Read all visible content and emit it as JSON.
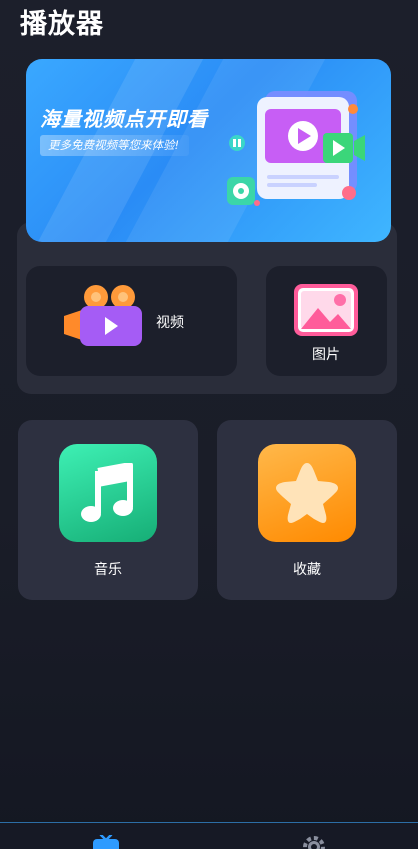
{
  "app": {
    "title": "播放器"
  },
  "banner": {
    "headline": "海量视频点开即看",
    "subtitle": "更多免费视频等您来体验!"
  },
  "cards": {
    "video": {
      "label": "视频",
      "icon": "video-camera-icon"
    },
    "photo": {
      "label": "图片",
      "icon": "image-icon"
    },
    "music": {
      "label": "音乐",
      "icon": "music-note-icon"
    },
    "favorites": {
      "label": "收藏",
      "icon": "star-icon"
    }
  },
  "nav": {
    "items": [
      {
        "icon": "tv-icon",
        "active": true
      },
      {
        "icon": "gear-icon",
        "active": false
      }
    ]
  },
  "colors": {
    "banner": "#2a8cf6",
    "music_gradient": [
      "#3be3a8",
      "#18b07a"
    ],
    "favorites_gradient": [
      "#ffb13b",
      "#ff8a00"
    ],
    "video_purple": "#9b5cf5",
    "video_orange": "#ff8a2a",
    "nav_accent": "#2e9bff"
  }
}
